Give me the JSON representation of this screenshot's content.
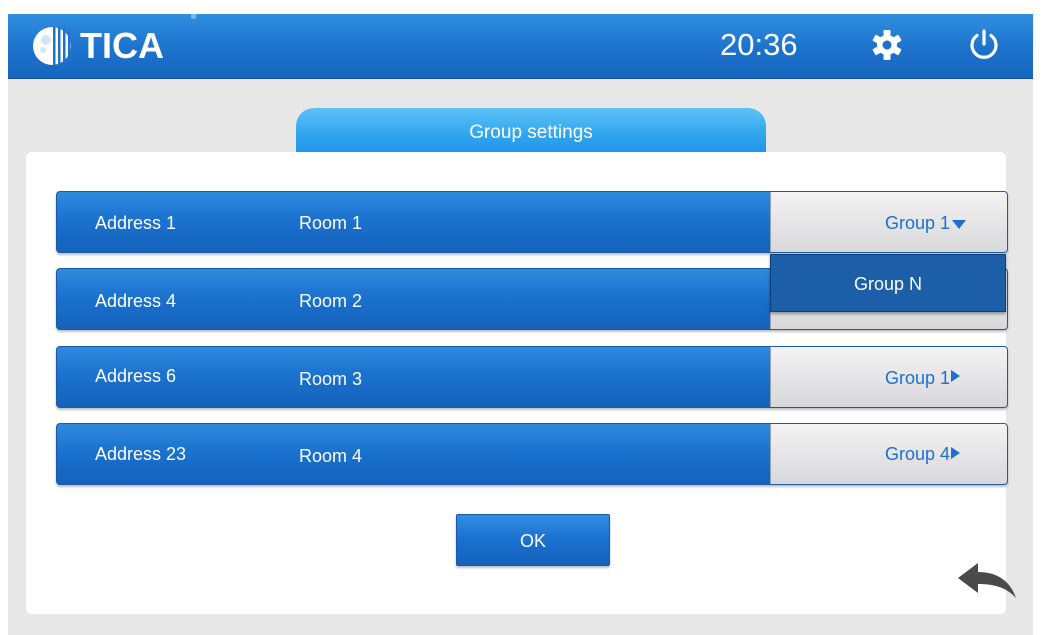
{
  "header": {
    "brand": "TICA",
    "brand_mark": "®",
    "time": "20:36",
    "settings_icon": "gear-icon",
    "power_icon": "power-icon"
  },
  "panel": {
    "title": "Group settings",
    "rows": [
      {
        "address": "Address 1",
        "room": "Room 1",
        "group": "Group 1",
        "indicator": "triangle-down-icon"
      },
      {
        "address": "Address 4",
        "room": "Room 2",
        "group": "",
        "indicator": ""
      },
      {
        "address": "Address 6",
        "room": "Room 3",
        "group": "Group 1",
        "indicator": "triangle-right-icon"
      },
      {
        "address": "Address 23",
        "room": "Room 4",
        "group": "Group 4",
        "indicator": "triangle-right-icon"
      }
    ],
    "dropdown_option": "Group N",
    "ok_label": "OK",
    "back_icon": "back-arrow-icon"
  },
  "colors": {
    "header_blue": "#1d72cc",
    "tab_blue": "#2ea3ee",
    "row_blue": "#1b72cf",
    "group_text_blue": "#1f6fd0",
    "dropdown_blue": "#1c5ea8",
    "background_gray": "#e7e7e8"
  }
}
